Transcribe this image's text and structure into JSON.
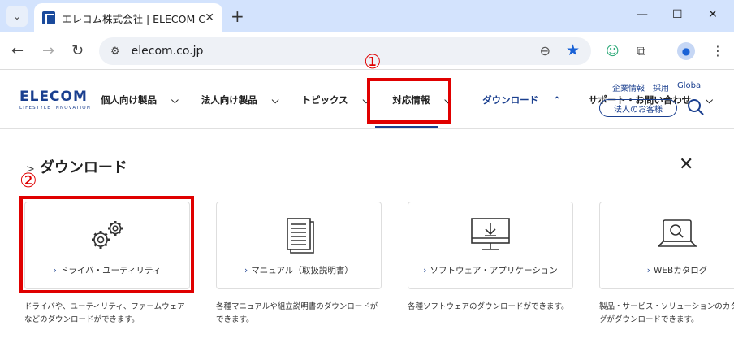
{
  "browser": {
    "tab_title": "エレコム株式会社 | ELECOM CO.,LTD.",
    "url": "elecom.co.jp"
  },
  "site": {
    "logo": "ELECOM",
    "logo_tagline": "LIFESTYLE INNOVATION",
    "nav": [
      {
        "label": "個人向け製品"
      },
      {
        "label": "法人向け製品"
      },
      {
        "label": "トピックス"
      },
      {
        "label": "対応情報"
      },
      {
        "label": "ダウンロード"
      },
      {
        "label": "サポート・お問い合わせ"
      }
    ],
    "util_links": [
      "企業情報",
      "採用",
      "Global"
    ],
    "corporate_button": "法人のお客様"
  },
  "annotations": {
    "mark1": "①",
    "mark2": "②",
    "color": "#e00000"
  },
  "panel": {
    "title": "ダウンロード",
    "cards": [
      {
        "label": "ドライバ・ユーティリティ",
        "icon": "gears-icon",
        "desc1": "ドライバや、ユーティリティ、ファームウェア",
        "desc2": "などのダウンロードができます。"
      },
      {
        "label": "マニュアル（取扱説明書）",
        "icon": "document-icon",
        "desc1": "各種マニュアルや組立説明書のダウンロードが",
        "desc2": "できます。"
      },
      {
        "label": "ソフトウェア・アプリケーション",
        "icon": "monitor-download-icon",
        "desc1": "各種ソフトウェアのダウンロードができます。",
        "desc2": ""
      },
      {
        "label": "WEBカタログ",
        "icon": "laptop-search-icon",
        "desc1": "製品・サービス・ソリューションのカタロ",
        "desc2": "グがダウンロードできます。"
      }
    ]
  },
  "colors": {
    "brand": "#1a3f8f",
    "chrome": "#d3e3fd"
  }
}
